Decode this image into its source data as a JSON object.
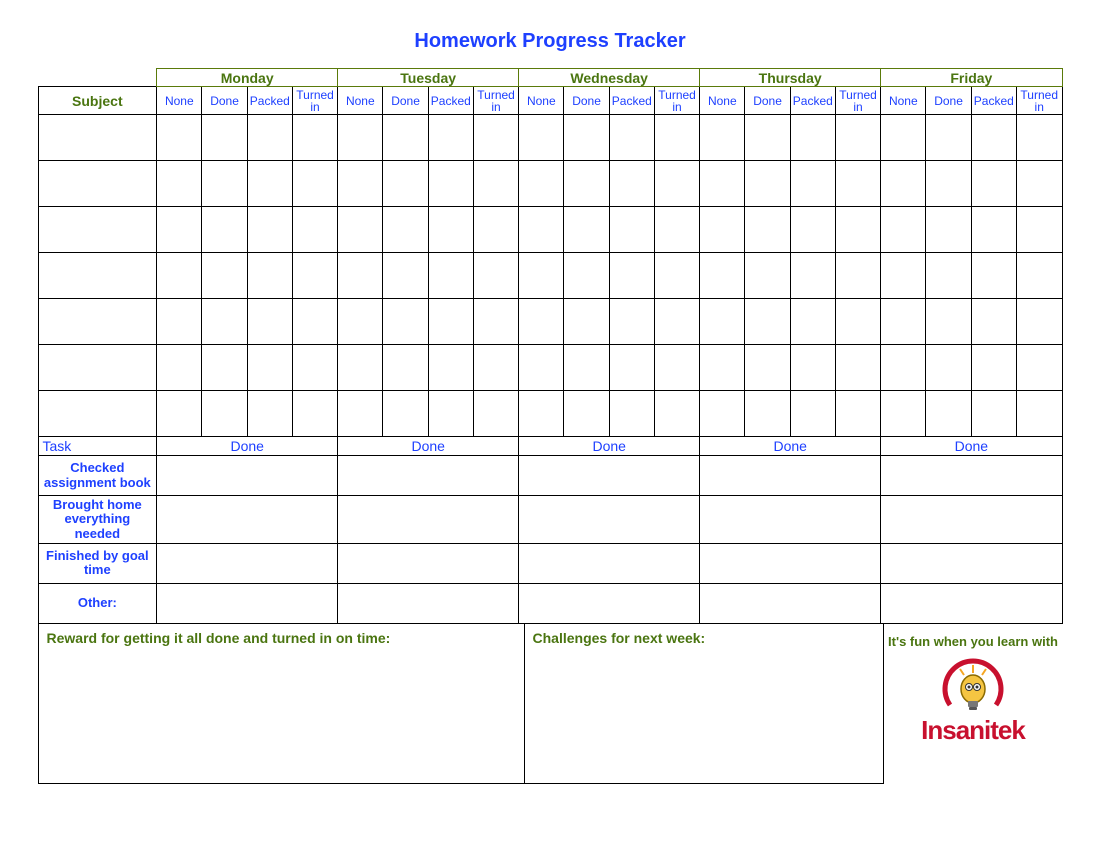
{
  "title": "Homework Progress Tracker",
  "days": [
    "Monday",
    "Tuesday",
    "Wednesday",
    "Thursday",
    "Friday"
  ],
  "statuses": [
    "None",
    "Done",
    "Packed",
    "Turned in"
  ],
  "subject_header": "Subject",
  "subject_rows": 7,
  "task_section": {
    "header": "Task",
    "done_label": "Done",
    "tasks": [
      "Checked assignment book",
      "Brought home everything needed",
      "Finished by goal time",
      "Other:"
    ]
  },
  "reward_label": "Reward for getting it all done and turned in on time:",
  "challenges_label": "Challenges for next week:",
  "logo": {
    "tagline": "It's fun when you learn with",
    "brand": "Insanitek"
  }
}
